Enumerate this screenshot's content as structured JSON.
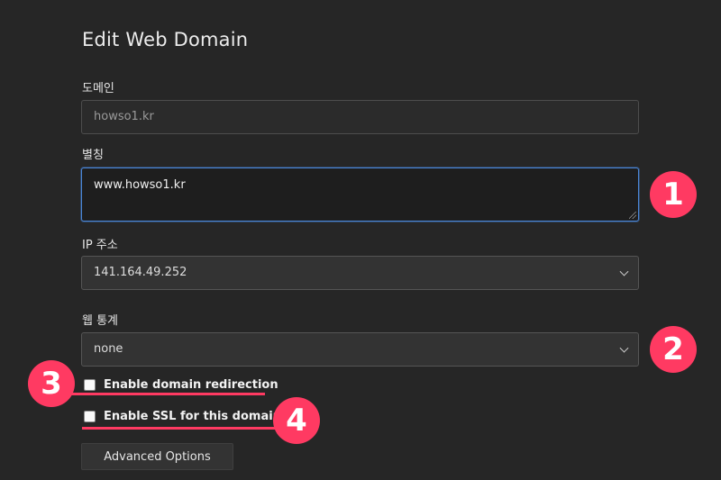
{
  "form": {
    "title": "Edit Web Domain",
    "domain": {
      "label": "도메인",
      "value": "howso1.kr"
    },
    "alias": {
      "label": "별칭",
      "value": "www.howso1.kr"
    },
    "ip": {
      "label": "IP 주소",
      "selected": "141.164.49.252"
    },
    "stats": {
      "label": "웹 통계",
      "selected": "none"
    },
    "redirect": {
      "label": "Enable domain redirection",
      "checked": false
    },
    "ssl": {
      "label": "Enable SSL for this domain",
      "checked": false
    },
    "advanced_label": "Advanced Options"
  },
  "annotations": {
    "color": "#ff3a62",
    "badges": [
      "1",
      "2",
      "3",
      "4"
    ]
  },
  "icons": {
    "select_arrow": "chevron-down-icon",
    "textarea_resize": "resize-grip-icon"
  }
}
